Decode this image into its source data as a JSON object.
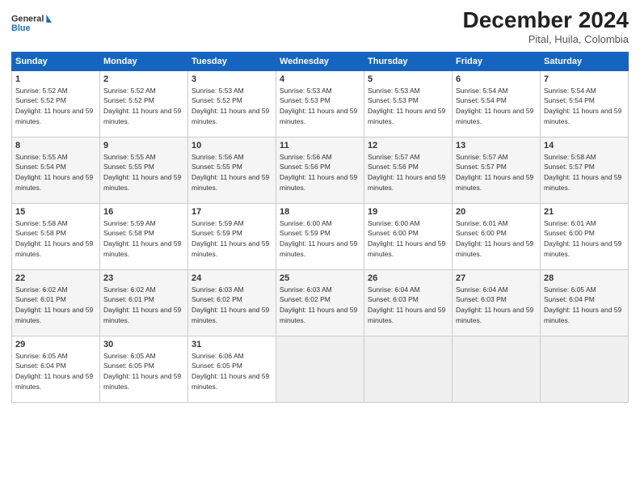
{
  "logo": {
    "line1": "General",
    "line2": "Blue"
  },
  "title": "December 2024",
  "subtitle": "Pital, Huila, Colombia",
  "weekdays": [
    "Sunday",
    "Monday",
    "Tuesday",
    "Wednesday",
    "Thursday",
    "Friday",
    "Saturday"
  ],
  "weeks": [
    [
      {
        "day": "1",
        "sunrise": "5:52 AM",
        "sunset": "5:52 PM",
        "daylight": "11 hours and 59 minutes."
      },
      {
        "day": "2",
        "sunrise": "5:52 AM",
        "sunset": "5:52 PM",
        "daylight": "11 hours and 59 minutes."
      },
      {
        "day": "3",
        "sunrise": "5:53 AM",
        "sunset": "5:52 PM",
        "daylight": "11 hours and 59 minutes."
      },
      {
        "day": "4",
        "sunrise": "5:53 AM",
        "sunset": "5:53 PM",
        "daylight": "11 hours and 59 minutes."
      },
      {
        "day": "5",
        "sunrise": "5:53 AM",
        "sunset": "5:53 PM",
        "daylight": "11 hours and 59 minutes."
      },
      {
        "day": "6",
        "sunrise": "5:54 AM",
        "sunset": "5:54 PM",
        "daylight": "11 hours and 59 minutes."
      },
      {
        "day": "7",
        "sunrise": "5:54 AM",
        "sunset": "5:54 PM",
        "daylight": "11 hours and 59 minutes."
      }
    ],
    [
      {
        "day": "8",
        "sunrise": "5:55 AM",
        "sunset": "5:54 PM",
        "daylight": "11 hours and 59 minutes."
      },
      {
        "day": "9",
        "sunrise": "5:55 AM",
        "sunset": "5:55 PM",
        "daylight": "11 hours and 59 minutes."
      },
      {
        "day": "10",
        "sunrise": "5:56 AM",
        "sunset": "5:55 PM",
        "daylight": "11 hours and 59 minutes."
      },
      {
        "day": "11",
        "sunrise": "5:56 AM",
        "sunset": "5:56 PM",
        "daylight": "11 hours and 59 minutes."
      },
      {
        "day": "12",
        "sunrise": "5:57 AM",
        "sunset": "5:56 PM",
        "daylight": "11 hours and 59 minutes."
      },
      {
        "day": "13",
        "sunrise": "5:57 AM",
        "sunset": "5:57 PM",
        "daylight": "11 hours and 59 minutes."
      },
      {
        "day": "14",
        "sunrise": "5:58 AM",
        "sunset": "5:57 PM",
        "daylight": "11 hours and 59 minutes."
      }
    ],
    [
      {
        "day": "15",
        "sunrise": "5:58 AM",
        "sunset": "5:58 PM",
        "daylight": "11 hours and 59 minutes."
      },
      {
        "day": "16",
        "sunrise": "5:59 AM",
        "sunset": "5:58 PM",
        "daylight": "11 hours and 59 minutes."
      },
      {
        "day": "17",
        "sunrise": "5:59 AM",
        "sunset": "5:59 PM",
        "daylight": "11 hours and 59 minutes."
      },
      {
        "day": "18",
        "sunrise": "6:00 AM",
        "sunset": "5:59 PM",
        "daylight": "11 hours and 59 minutes."
      },
      {
        "day": "19",
        "sunrise": "6:00 AM",
        "sunset": "6:00 PM",
        "daylight": "11 hours and 59 minutes."
      },
      {
        "day": "20",
        "sunrise": "6:01 AM",
        "sunset": "6:00 PM",
        "daylight": "11 hours and 59 minutes."
      },
      {
        "day": "21",
        "sunrise": "6:01 AM",
        "sunset": "6:00 PM",
        "daylight": "11 hours and 59 minutes."
      }
    ],
    [
      {
        "day": "22",
        "sunrise": "6:02 AM",
        "sunset": "6:01 PM",
        "daylight": "11 hours and 59 minutes."
      },
      {
        "day": "23",
        "sunrise": "6:02 AM",
        "sunset": "6:01 PM",
        "daylight": "11 hours and 59 minutes."
      },
      {
        "day": "24",
        "sunrise": "6:03 AM",
        "sunset": "6:02 PM",
        "daylight": "11 hours and 59 minutes."
      },
      {
        "day": "25",
        "sunrise": "6:03 AM",
        "sunset": "6:02 PM",
        "daylight": "11 hours and 59 minutes."
      },
      {
        "day": "26",
        "sunrise": "6:04 AM",
        "sunset": "6:03 PM",
        "daylight": "11 hours and 59 minutes."
      },
      {
        "day": "27",
        "sunrise": "6:04 AM",
        "sunset": "6:03 PM",
        "daylight": "11 hours and 59 minutes."
      },
      {
        "day": "28",
        "sunrise": "6:05 AM",
        "sunset": "6:04 PM",
        "daylight": "11 hours and 59 minutes."
      }
    ],
    [
      {
        "day": "29",
        "sunrise": "6:05 AM",
        "sunset": "6:04 PM",
        "daylight": "11 hours and 59 minutes."
      },
      {
        "day": "30",
        "sunrise": "6:05 AM",
        "sunset": "6:05 PM",
        "daylight": "11 hours and 59 minutes."
      },
      {
        "day": "31",
        "sunrise": "6:06 AM",
        "sunset": "6:05 PM",
        "daylight": "11 hours and 59 minutes."
      },
      null,
      null,
      null,
      null
    ]
  ]
}
